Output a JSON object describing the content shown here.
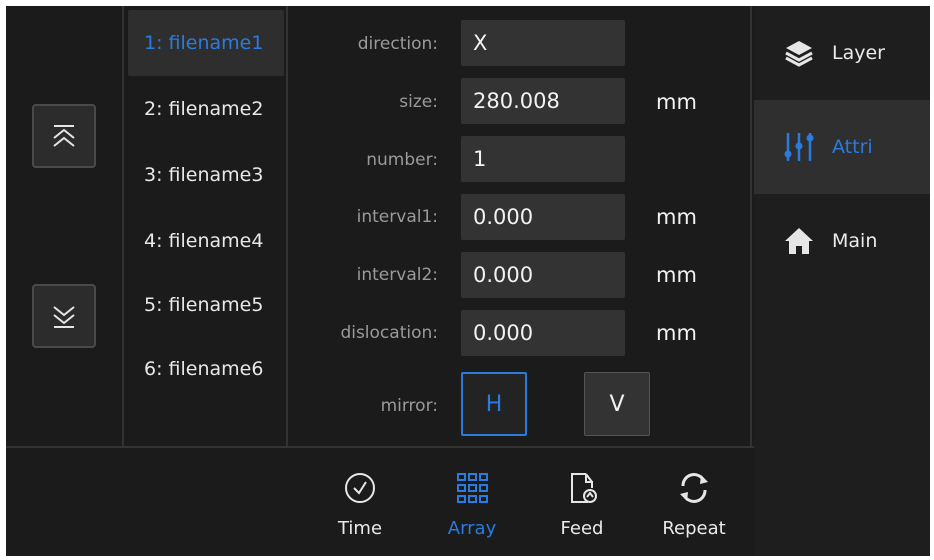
{
  "colors": {
    "accent": "#2a7be0",
    "background": "#1b1b1b",
    "field": "#333333"
  },
  "navigation": {
    "up_icon": "double-chevron-up-icon",
    "down_icon": "double-chevron-down-icon"
  },
  "files": [
    {
      "label": "1: filename1",
      "selected": true
    },
    {
      "label": "2: filename2",
      "selected": false
    },
    {
      "label": "3: filename3",
      "selected": false
    },
    {
      "label": "4: filename4",
      "selected": false
    },
    {
      "label": "5: filename5",
      "selected": false
    },
    {
      "label": "6: filename6",
      "selected": false
    }
  ],
  "attributes": {
    "direction": {
      "label": "direction:",
      "value": "X"
    },
    "size": {
      "label": "size:",
      "value": "280.008",
      "unit": "mm"
    },
    "number": {
      "label": "number:",
      "value": "1"
    },
    "interval1": {
      "label": "interval1:",
      "value": "0.000",
      "unit": "mm"
    },
    "interval2": {
      "label": "interval2:",
      "value": "0.000",
      "unit": "mm"
    },
    "dislocation": {
      "label": "dislocation:",
      "value": "0.000",
      "unit": "mm"
    },
    "mirror": {
      "label": "mirror:",
      "h": "H",
      "v": "V",
      "selected": "H"
    }
  },
  "side_menu": [
    {
      "label": "Layer",
      "icon": "layers-icon",
      "active": false
    },
    {
      "label": "Attri",
      "icon": "sliders-icon",
      "active": true
    },
    {
      "label": "Main",
      "icon": "home-icon",
      "active": false
    }
  ],
  "toolbar": [
    {
      "label": "Time",
      "icon": "clock-icon",
      "active": false
    },
    {
      "label": "Array",
      "icon": "grid-icon",
      "active": true
    },
    {
      "label": "Feed",
      "icon": "file-upload-icon",
      "active": false
    },
    {
      "label": "Repeat",
      "icon": "repeat-icon",
      "active": false
    }
  ]
}
